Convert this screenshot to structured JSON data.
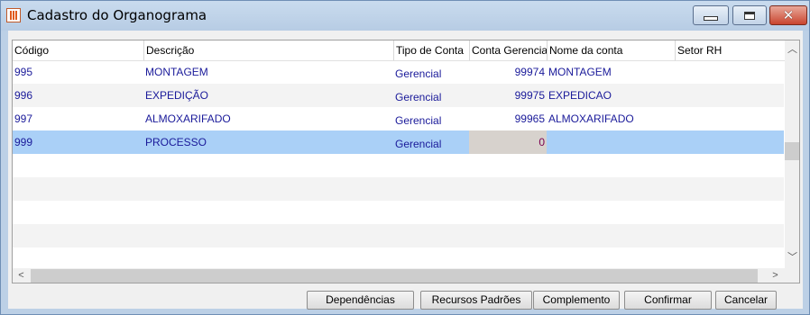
{
  "window": {
    "title": "Cadastro do Organograma"
  },
  "columns": {
    "codigo": "Código",
    "descricao": "Descrição",
    "tipo": "Tipo de Conta",
    "conta": "Conta Gerencial",
    "nome": "Nome da conta",
    "setor": "Setor RH"
  },
  "rows": [
    {
      "codigo": "995",
      "descricao": "MONTAGEM",
      "tipo": "Gerencial",
      "conta": "99974",
      "nome": "MONTAGEM",
      "setor": ""
    },
    {
      "codigo": "996",
      "descricao": "EXPEDIÇÃO",
      "tipo": "Gerencial",
      "conta": "99975",
      "nome": "EXPEDICAO",
      "setor": ""
    },
    {
      "codigo": "997",
      "descricao": "ALMOXARIFADO",
      "tipo": "Gerencial",
      "conta": "99965",
      "nome": "ALMOXARIFADO",
      "setor": ""
    },
    {
      "codigo": "999",
      "descricao": "PROCESSO",
      "tipo": "Gerencial",
      "conta": "0",
      "nome": "",
      "setor": ""
    }
  ],
  "selected_row": 3,
  "buttons": {
    "dependencias": "Dependências",
    "recursos": "Recursos Padrões",
    "complemento": "Complemento",
    "confirmar": "Confirmar",
    "cancelar": "Cancelar"
  },
  "icons": {
    "app": "organogram-app-icon",
    "minimize": "minimize-icon",
    "maximize": "maximize-icon",
    "close": "close-icon",
    "scroll_up": "chevron-up-icon",
    "scroll_down": "chevron-down-icon",
    "scroll_left": "chevron-left-icon",
    "scroll_right": "chevron-right-icon"
  }
}
